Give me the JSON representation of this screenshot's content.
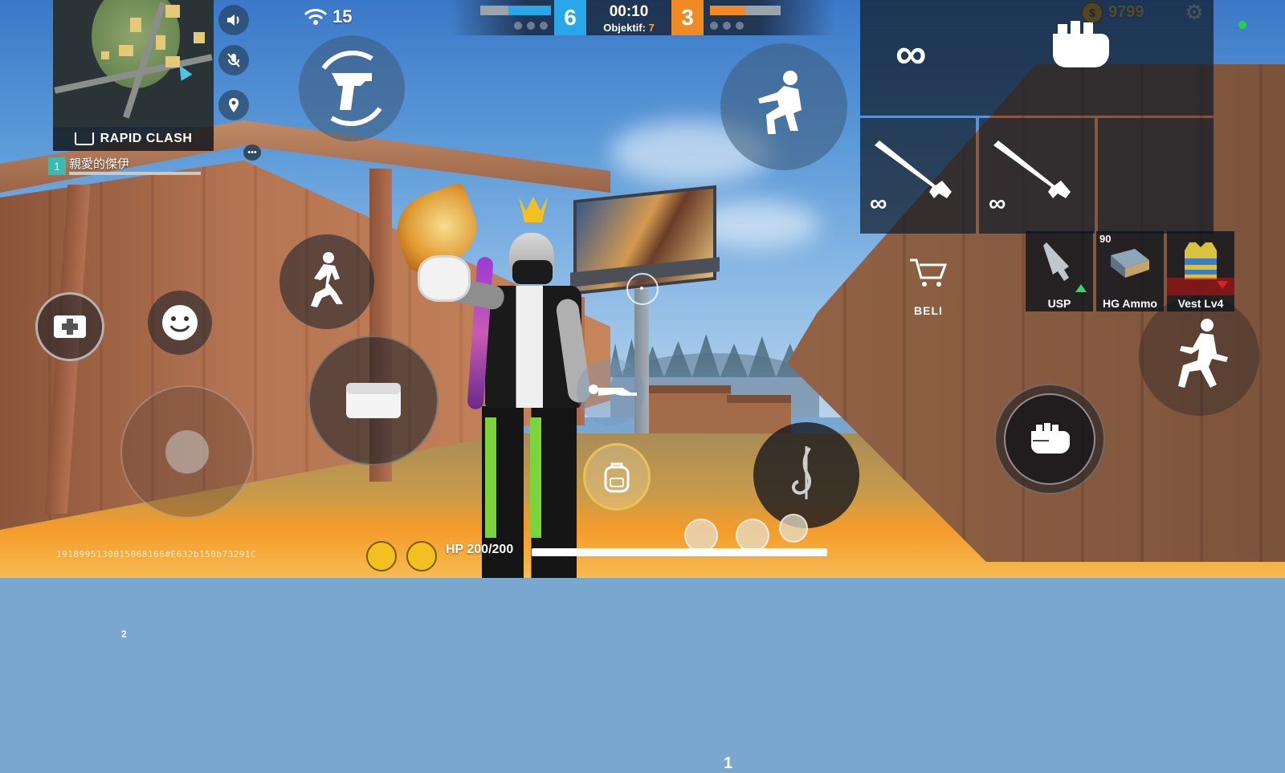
{
  "hud": {
    "mode_label": "RAPID CLASH",
    "ping": "15",
    "coins": "9799",
    "player": {
      "index": "1",
      "name": "親愛的傑伊"
    },
    "hp_label": "HP 200/200",
    "bottom_id": "1918995130015068166#E632b150b73291C",
    "heal_count": "2",
    "grenade_count": "1",
    "shop_label": "BELI",
    "accent_blue": "#2aa7e8",
    "accent_orange": "#f08a24"
  },
  "scoreboard": {
    "blue_score": "6",
    "orange_score": "3",
    "timer": "00:10",
    "objective_label": "Objektif:",
    "objective_value": "7",
    "blue_fill": 0.6,
    "orange_fill": 0.55
  },
  "weapons": {
    "primary_ammo": "∞",
    "slot1_ammo": "∞",
    "slot2_ammo": "∞"
  },
  "loot": [
    {
      "label": "USP",
      "count": "",
      "indicator": "up"
    },
    {
      "label": "HG Ammo",
      "count": "90",
      "indicator": ""
    },
    {
      "label": "Vest Lv4",
      "count": "",
      "indicator": "down"
    }
  ],
  "icons": {
    "swap_weapon": "pistol-swap-icon",
    "crouch": "crouch-icon",
    "run": "run-icon",
    "emote": "smile-icon",
    "grenade": "grenade-icon",
    "heal": "medkit-icon",
    "backpack": "backpack-icon",
    "prone": "prone-icon",
    "music": "music-note-icon",
    "jump": "jump-icon",
    "fire": "fist-icon",
    "settings": "gear-icon",
    "shop": "cart-icon"
  }
}
